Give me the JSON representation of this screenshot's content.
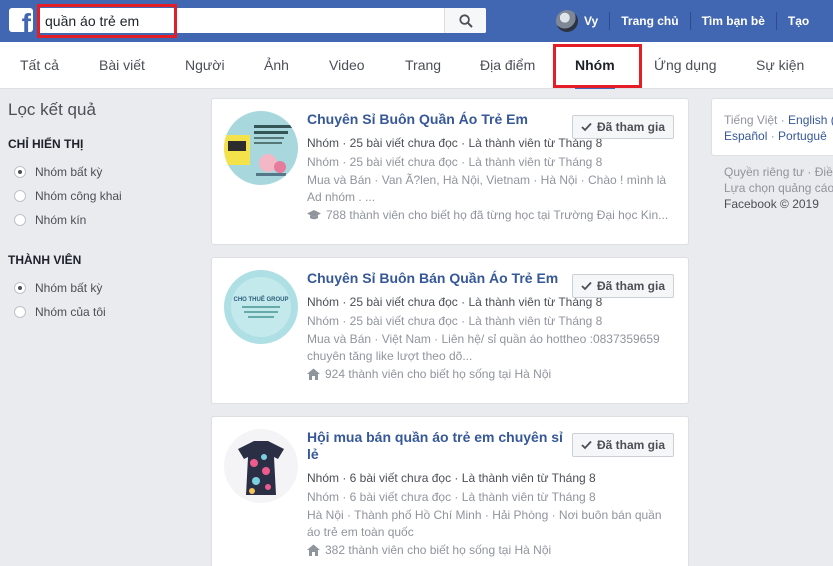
{
  "search": {
    "value": "quần áo trẻ em"
  },
  "nav": {
    "user": "Vy",
    "links": [
      "Trang chủ",
      "Tìm bạn bè",
      "Tạo"
    ]
  },
  "tabs": [
    "Tất cả",
    "Bài viết",
    "Người",
    "Ảnh",
    "Video",
    "Trang",
    "Địa điểm",
    "Nhóm",
    "Ứng dụng",
    "Sự kiện"
  ],
  "active_tab": "Nhóm",
  "filter": {
    "title": "Lọc kết quả",
    "sections": [
      {
        "heading": "CHỈ HIỂN THỊ",
        "options": [
          "Nhóm bất kỳ",
          "Nhóm công khai",
          "Nhóm kín"
        ],
        "selected": 0
      },
      {
        "heading": "THÀNH VIÊN",
        "options": [
          "Nhóm bất kỳ",
          "Nhóm của tôi"
        ],
        "selected": 0
      }
    ]
  },
  "results": [
    {
      "title": "Chuyên Sỉ Buôn Quần Áo Trẻ Em",
      "line1": "Nhóm · 25 bài viết chưa đọc · Là thành viên từ Tháng 8",
      "line2": "Nhóm · 25 bài viết chưa đọc · Là thành viên từ Tháng 8",
      "desc": "Mua và Bán · Van Ã?len, Hà Nội, Vietnam · Hà Nội · Chào ! mình là Ad nhóm . ...",
      "foot": "788 thành viên cho biết họ đã từng học tại Trường Đại học Kin...",
      "foot_icon": "graduation-cap-icon",
      "button": "Đã tham gia"
    },
    {
      "title": "Chuyên Sỉ Buôn Bán Quần Áo Trẻ Em",
      "line1": "Nhóm · 25 bài viết chưa đọc · Là thành viên từ Tháng 8",
      "line2": "Nhóm · 25 bài viết chưa đọc · Là thành viên từ Tháng 8",
      "desc": "Mua và Bán · Việt Nam · Liên hệ/ sỉ quần áo hottheo :0837359659 chuyên tăng like lượt theo dõ...",
      "foot": "924 thành viên cho biết họ sống tại Hà Nội",
      "foot_icon": "home-icon",
      "button": "Đã tham gia",
      "img_text": "CHO THUÊ GROUP"
    },
    {
      "title": "Hội mua bán quần áo trẻ em chuyên sỉ lẻ",
      "line1": "Nhóm · 6 bài viết chưa đọc · Là thành viên từ Tháng 8",
      "line2": "Nhóm · 6 bài viết chưa đọc · Là thành viên từ Tháng 8",
      "desc": "Hà Nội · Thành phố Hồ Chí Minh · Hải Phòng · Nơi buôn bán quần áo trẻ em toàn quốc",
      "foot": "382 thành viên cho biết họ sống tại Hà Nội",
      "foot_icon": "home-icon",
      "button": "Đã tham gia"
    }
  ],
  "right": {
    "lang_current": "Tiếng Việt",
    "lang_links": [
      "English (",
      "Español",
      "Portuguê"
    ],
    "footer_line1": "Quyền riêng tư · Điề",
    "footer_line2": "Lựa chọn quảng cáo",
    "copyright": "Facebook © 2019"
  }
}
